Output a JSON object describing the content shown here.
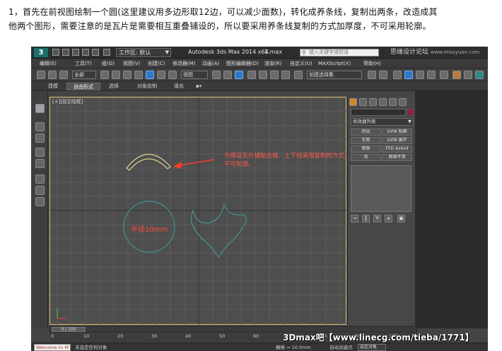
{
  "caption": {
    "line1": "1，首先在前视图绘制一个圆(这里建议用多边形取12边，可以减少面数)，转化成养条线，复制出两条，改造成其",
    "line2": "他两个图形，需要注意的是瓦片是需要相互重叠铺设的，所以要采用养条线复制的方式加厚度，不可采用轮廓。"
  },
  "titlebar": {
    "logo": "3",
    "workspace_label": "工作区: 默认",
    "app_title": "Autodesk 3ds Max  2014 x64",
    "file_name": "1.max",
    "search_placeholder": "键入关键字或短语",
    "watermark": "思缘设计论坛",
    "watermark_url": "www.missyuan.com"
  },
  "menubar": {
    "items": [
      "编辑(E)",
      "工具(T)",
      "组(G)",
      "视图(V)",
      "创建(C)",
      "修改器(M)",
      "动画(A)",
      "图形编辑器(D)",
      "渲染(R)",
      "自定义(U)",
      "MAXScript(X)",
      "帮助(H)"
    ]
  },
  "toolbar": {
    "filter_select": "全部",
    "view_select": "视图",
    "named_selection": "创建选择集"
  },
  "ribbon": {
    "tabs": [
      "建模",
      "自由形式",
      "选择",
      "对象绘制",
      "填充"
    ],
    "active_index": 1
  },
  "viewport": {
    "label": "[+][前][线框]",
    "annotation": "为保证瓦片铺贴合缝，上下线采用复制的方式，不可轮廓。",
    "radius_label": "半径10mm",
    "shape_color": "#3aa3a3",
    "arc_color": "#d9cf92",
    "annotation_color": "#ff4a3a"
  },
  "command_panel": {
    "modifier_list": "修改器列表",
    "buttons": [
      "挤出",
      "UVW 贴图",
      "车削",
      "UVW 展开",
      "倒角",
      "FFD 4x4x4",
      "壳",
      "网格平滑"
    ]
  },
  "timeline": {
    "position": "0 / 100",
    "ticks": [
      "0",
      "10",
      "20",
      "30",
      "40",
      "50",
      "60",
      "70",
      "80",
      "90",
      "100"
    ]
  },
  "statusbar": {
    "maxscript": "Welcome to M",
    "message": "未选定任何对象",
    "grid": "栅格 = 10.0mm",
    "auto_key": "自动关键点",
    "selection_select": "选定对象"
  },
  "forum_watermark": "3Dmax吧【www.linecg.com/tieba/1771】"
}
